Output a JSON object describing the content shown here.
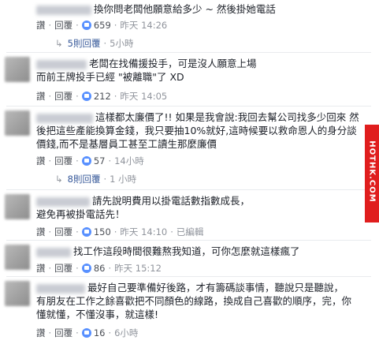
{
  "comments": [
    {
      "text_lines": [
        "換你問老闆他願意給多少 ~ 然後掛她電話"
      ],
      "like": "讚",
      "reply": "回覆",
      "likes": "659",
      "time": "昨天 14:26",
      "replies": "5則回覆",
      "reply_time": "5小時"
    },
    {
      "text_lines": [
        "老闆在找備援投手，可是沒人願意上場",
        "而前王牌投手已經 \"被離職\"了  XD"
      ],
      "like": "讚",
      "reply": "回覆",
      "likes": "212",
      "time": "昨天 14:05"
    },
    {
      "text_lines": [
        "這樣都太廉價了!! 如果是我會說:我回去幫公司找多少回來 然",
        "後把這些產能換算金錢，我只要抽10%就好,這時候要以救命恩人的身分談",
        "價錢,而不是基層員工甚至工讀生那麼廉價"
      ],
      "like": "讚",
      "reply": "回覆",
      "likes": "57",
      "time": "14小時",
      "replies": "8則回覆",
      "reply_time": "1 小時"
    },
    {
      "text_lines": [
        "請先說明費用以掛電話數指數成長，",
        "避免再被掛電話先！"
      ],
      "like": "讚",
      "reply": "回覆",
      "likes": "150",
      "time": "昨天 14:10",
      "edited": "已編輯"
    },
    {
      "text_lines": [
        "找工作這段時間很難熬我知道，可你怎麼就這樣瘋了"
      ],
      "like": "讚",
      "reply": "回覆",
      "likes": "86",
      "time": "昨天 15:12"
    },
    {
      "text_lines": [
        "最好自己要準備好後路，才有籌碼談事情，聽說只是聽說，",
        "有朋友在工作之餘喜歡把不同顏色的線路，換成自己喜歡的順序，完，你",
        "懂就懂，不懂沒事，就這樣!"
      ],
      "like": "讚",
      "reply": "回覆",
      "likes": "16",
      "time": "6小時"
    }
  ],
  "watermark": "HOTHK.COM",
  "colors": {
    "link": "#365899",
    "meta": "#90949c",
    "like_icon": "#5890ff",
    "watermark_bg": "#e01e1e"
  }
}
